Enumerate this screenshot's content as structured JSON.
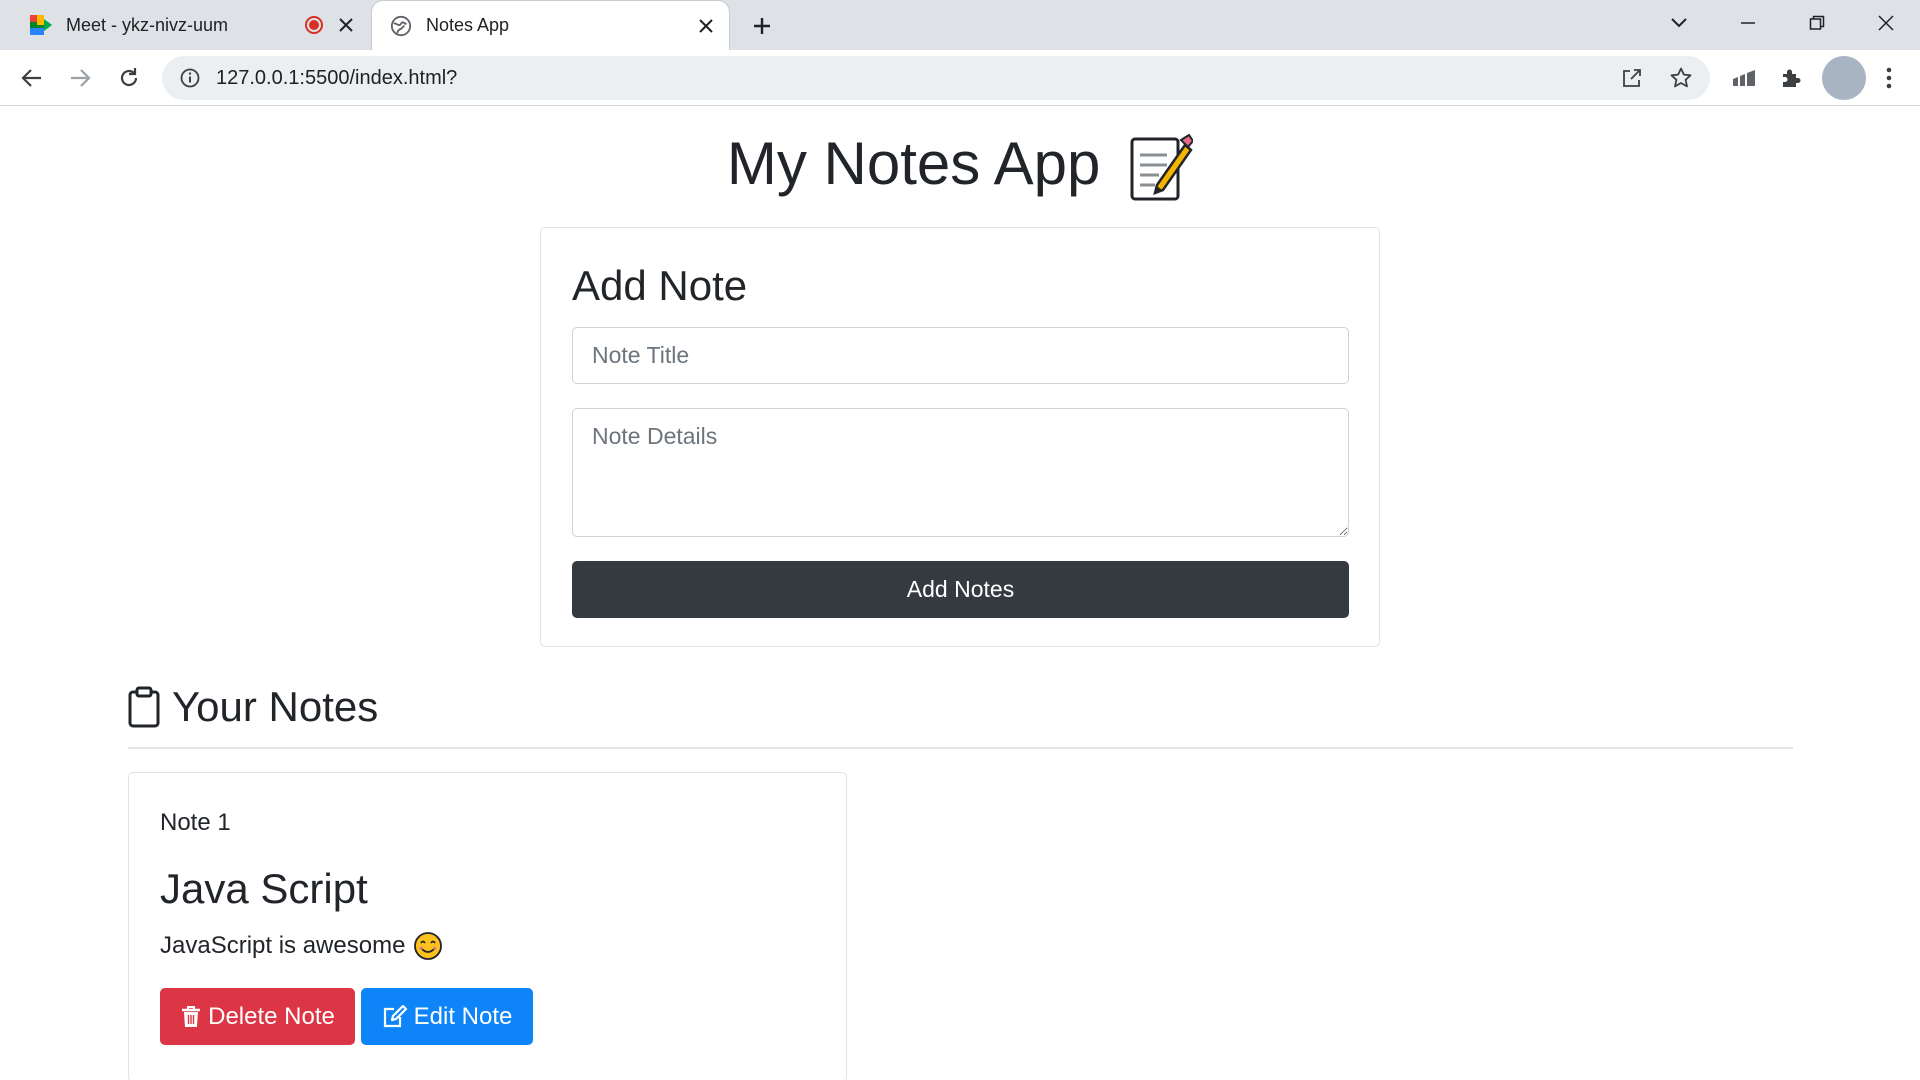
{
  "browser": {
    "tabs": [
      {
        "label": "Meet - ykz-nivz-uum",
        "icon": "google-meet-icon",
        "recording": true,
        "active": false
      },
      {
        "label": "Notes App",
        "icon": "globe-icon",
        "active": true
      }
    ],
    "address_bar": {
      "url": "127.0.0.1:5500/index.html?"
    }
  },
  "app": {
    "title": "My Notes App",
    "title_emoji": "memo-icon"
  },
  "add_note": {
    "heading": "Add Note",
    "title_placeholder": "Note Title",
    "details_placeholder": "Note Details",
    "submit_label": "Add Notes"
  },
  "notes_section": {
    "heading": "Your Notes",
    "icon": "clipboard-icon",
    "notes": [
      {
        "number": "Note 1",
        "title": "Java Script",
        "body": "JavaScript is awesome",
        "body_emoji": "smiling-face-icon",
        "delete_label": "Delete Note",
        "edit_label": "Edit Note"
      }
    ]
  },
  "colors": {
    "primary_dark": "#343a40",
    "danger": "#dc3545",
    "primary": "#0d84f7"
  }
}
